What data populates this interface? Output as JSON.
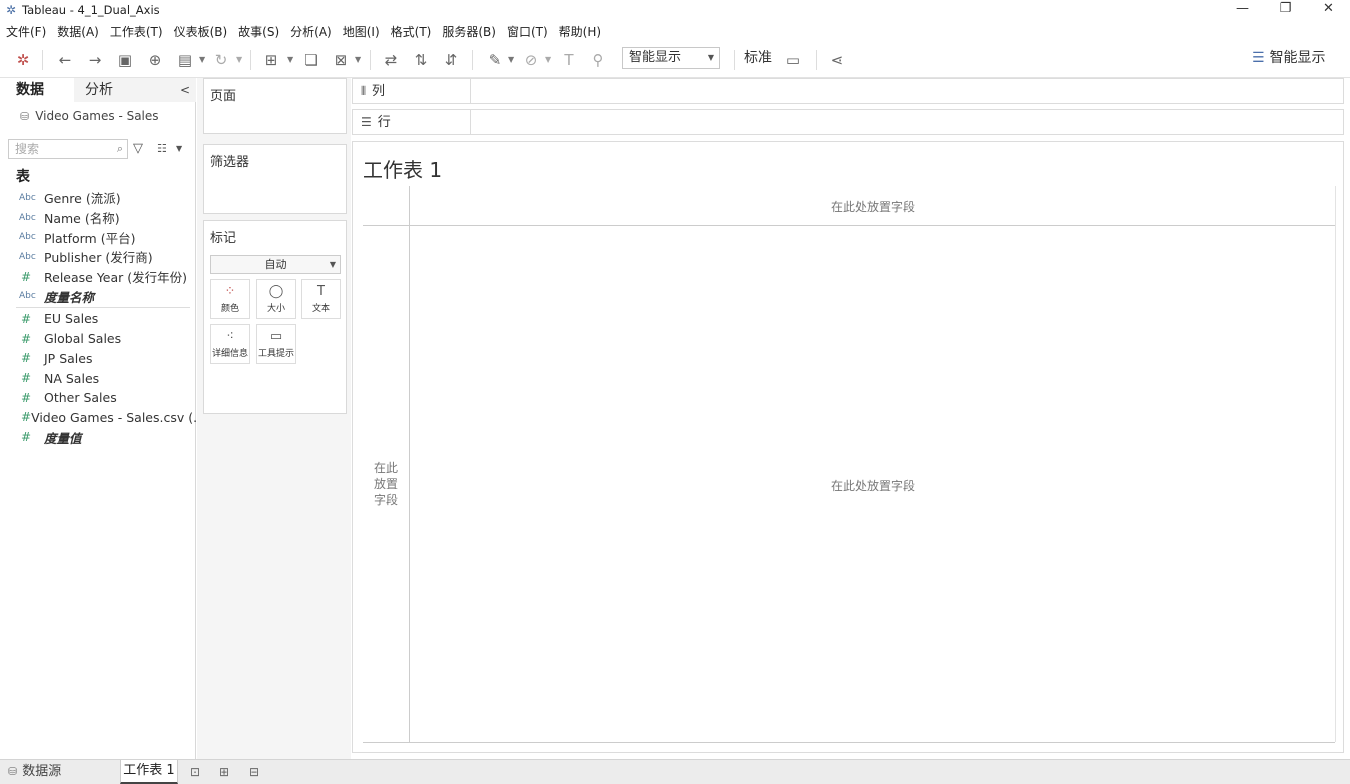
{
  "window": {
    "title": "Tableau - 4_1_Dual_Axis",
    "controls": [
      "—",
      "❐",
      "✕"
    ]
  },
  "menu": [
    "文件(F)",
    "数据(A)",
    "工作表(T)",
    "仪表板(B)",
    "故事(S)",
    "分析(A)",
    "地图(I)",
    "格式(T)",
    "服务器(B)",
    "窗口(T)",
    "帮助(H)"
  ],
  "toolbar": {
    "show_me_select": "智能显示",
    "standard_label": "标准",
    "smart_show_button": "智能显示"
  },
  "data_pane": {
    "tab_data": "数据",
    "tab_analysis": "分析",
    "collapse": "<",
    "datasource": "Video Games - Sales",
    "search_placeholder": "搜索",
    "tables_header": "表",
    "dimensions": [
      {
        "type": "Abc",
        "name": "Genre (流派)"
      },
      {
        "type": "Abc",
        "name": "Name (名称)"
      },
      {
        "type": "Abc",
        "name": "Platform (平台)"
      },
      {
        "type": "Abc",
        "name": "Publisher (发行商)"
      },
      {
        "type": "#",
        "name": "Release Year (发行年份)"
      },
      {
        "type": "Abc",
        "name": "度量名称"
      }
    ],
    "measures": [
      {
        "type": "#",
        "name": "EU Sales"
      },
      {
        "type": "#",
        "name": "Global Sales"
      },
      {
        "type": "#",
        "name": "JP Sales"
      },
      {
        "type": "#",
        "name": "NA Sales"
      },
      {
        "type": "#",
        "name": "Other Sales"
      },
      {
        "type": "#",
        "name": "Video Games - Sales.csv (..."
      },
      {
        "type": "#",
        "name": "度量值"
      }
    ]
  },
  "shelves": {
    "pages": "页面",
    "filters": "筛选器",
    "marks": "标记",
    "mark_type": "自动",
    "mark_buttons": [
      "颜色",
      "大小",
      "文本",
      "详细信息",
      "工具提示"
    ],
    "columns": "列",
    "rows": "行"
  },
  "worksheet": {
    "title": "工作表 1",
    "column_drop": "在此处放置字段",
    "row_drop": "在此\n放置\n字段",
    "center_drop": "在此处放置字段"
  },
  "tabs": {
    "datasource": "数据源",
    "sheet1": "工作表 1"
  }
}
